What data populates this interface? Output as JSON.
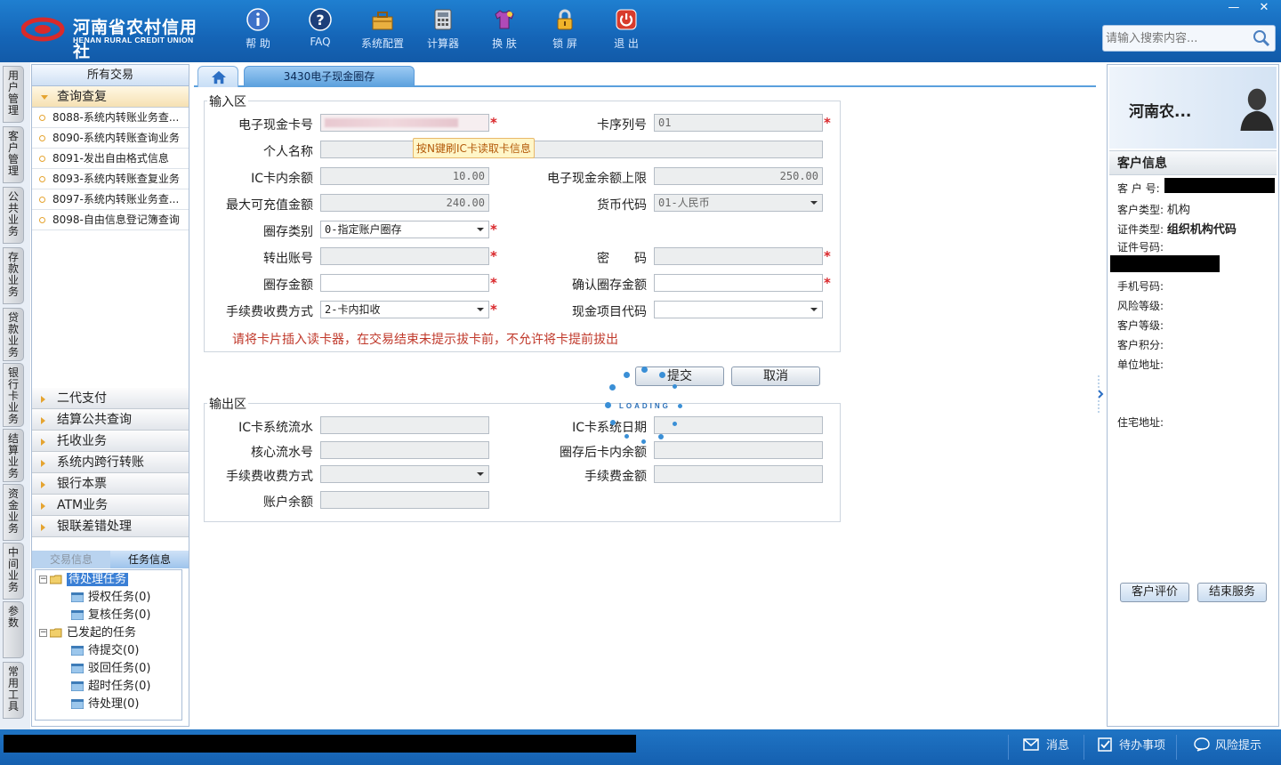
{
  "app": {
    "logo_cn": "河南省农村信用社",
    "logo_en": "HENAN RURAL CREDIT UNION",
    "toolbar": [
      {
        "label": "帮 助",
        "icon": "info-icon"
      },
      {
        "label": "FAQ",
        "icon": "question-icon"
      },
      {
        "label": "系统配置",
        "icon": "toolbox-icon"
      },
      {
        "label": "计算器",
        "icon": "calculator-icon"
      },
      {
        "label": "换 肤",
        "icon": "shirt-icon"
      },
      {
        "label": "锁 屏",
        "icon": "lock-icon"
      },
      {
        "label": "退 出",
        "icon": "power-icon"
      }
    ],
    "window_controls": {
      "minimize": "—",
      "close": "✕"
    },
    "search_placeholder": "请输入搜索内容..."
  },
  "left_tabs": [
    "用户管理",
    "客户管理",
    "公共业务",
    "存款业务",
    "贷款业务",
    "银行卡业务",
    "结算业务",
    "资金业务",
    "中间业务",
    "参数",
    "常用工具"
  ],
  "nav": {
    "header": "所有交易",
    "open_group": "查询查复",
    "sub_items": [
      "8088-系统内转账业务查...",
      "8090-系统内转账查询业务",
      "8091-发出自由格式信息",
      "8093-系统内转账查复业务",
      "8097-系统内转账业务查...",
      "8098-自由信息登记簿查询"
    ],
    "groups": [
      "二代支付",
      "结算公共查询",
      "托收业务",
      "系统内跨行转账",
      "银行本票",
      "ATM业务",
      "银联差错处理"
    ]
  },
  "tasks": {
    "tabs": [
      "交易信息",
      "任务信息"
    ],
    "tree": {
      "pending": "待处理任务",
      "auth": "授权任务(0)",
      "review": "复核任务(0)",
      "initiated": "已发起的任务",
      "to_submit": "待提交(0)",
      "rejected": "驳回任务(0)",
      "timeout": "超时任务(0)",
      "to_process": "待处理(0)"
    }
  },
  "doc_tab": "3430电子现金圈存",
  "input_area": {
    "legend": "输入区",
    "card_no_label": "电子现金卡号",
    "card_seq_label": "卡序列号",
    "card_seq_value": "01",
    "name_label": "个人名称",
    "tooltip": "按N键刷IC卡读取卡信息",
    "ic_balance_label": "IC卡内余额",
    "ic_balance_value": "10.00",
    "ecash_limit_label": "电子现金余额上限",
    "ecash_limit_value": "250.00",
    "max_load_label": "最大可充值金额",
    "max_load_value": "240.00",
    "currency_label": "货币代码",
    "currency_value": "01-人民币",
    "load_type_label": "圈存类别",
    "load_type_value": "0-指定账户圈存",
    "out_account_label": "转出账号",
    "password_label": "密　　码",
    "load_amount_label": "圈存金额",
    "confirm_amount_label": "确认圈存金额",
    "fee_method_label": "手续费收费方式",
    "fee_method_value": "2-卡内扣收",
    "cash_item_label": "现金项目代码",
    "warning": "请将卡片插入读卡器，在交易结束未提示拔卡前，不允许将卡提前拔出"
  },
  "buttons": {
    "submit": "提交",
    "cancel": "取消"
  },
  "loading_text": "LOADING",
  "output_area": {
    "legend": "输出区",
    "ic_serial_label": "IC卡系统流水",
    "ic_date_label": "IC卡系统日期",
    "core_serial_label": "核心流水号",
    "after_balance_label": "圈存后卡内余额",
    "fee_method_label": "手续费收费方式",
    "fee_amount_label": "手续费金额",
    "account_balance_label": "账户余额"
  },
  "customer": {
    "name": "河南农...",
    "section": "客户信息",
    "cust_no_label": "客 户 号:",
    "cust_type_label": "客户类型:",
    "cust_type_value": "机构",
    "id_type_label": "证件类型:",
    "id_type_value": "组织机构代码",
    "id_no_label": "证件号码:",
    "phone_label": "手机号码:",
    "risk_label": "风险等级:",
    "level_label": "客户等级:",
    "points_label": "客户积分:",
    "work_addr_label": "单位地址:",
    "home_addr_label": "住宅地址:",
    "eval_button": "客户评价",
    "end_button": "结束服务"
  },
  "statusbar": {
    "message": "消息",
    "todo": "待办事项",
    "risk": "风险提示"
  },
  "colors": {
    "brand_blue": "#1565b7",
    "tab_blue": "#5aa0dd",
    "required_red": "#d9262a",
    "warning_red": "#c0392b"
  }
}
